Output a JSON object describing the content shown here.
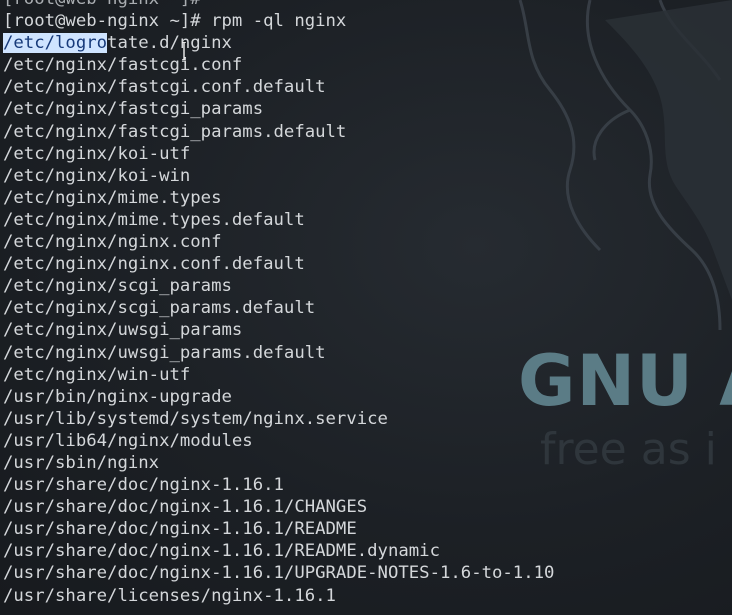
{
  "terminal": {
    "lines": [
      {
        "text": "[root@web-nginx ~]#"
      },
      {
        "text": "[root@web-nginx ~]# rpm -ql nginx"
      },
      {
        "selected": "/etc/logro",
        "rest": "tate.d/nginx"
      },
      {
        "text": "/etc/nginx/fastcgi.conf"
      },
      {
        "text": "/etc/nginx/fastcgi.conf.default"
      },
      {
        "text": "/etc/nginx/fastcgi_params"
      },
      {
        "text": "/etc/nginx/fastcgi_params.default"
      },
      {
        "text": "/etc/nginx/koi-utf"
      },
      {
        "text": "/etc/nginx/koi-win"
      },
      {
        "text": "/etc/nginx/mime.types"
      },
      {
        "text": "/etc/nginx/mime.types.default"
      },
      {
        "text": "/etc/nginx/nginx.conf"
      },
      {
        "text": "/etc/nginx/nginx.conf.default"
      },
      {
        "text": "/etc/nginx/scgi_params"
      },
      {
        "text": "/etc/nginx/scgi_params.default"
      },
      {
        "text": "/etc/nginx/uwsgi_params"
      },
      {
        "text": "/etc/nginx/uwsgi_params.default"
      },
      {
        "text": "/etc/nginx/win-utf"
      },
      {
        "text": "/usr/bin/nginx-upgrade"
      },
      {
        "text": "/usr/lib/systemd/system/nginx.service"
      },
      {
        "text": "/usr/lib64/nginx/modules"
      },
      {
        "text": "/usr/sbin/nginx"
      },
      {
        "text": "/usr/share/doc/nginx-1.16.1"
      },
      {
        "text": "/usr/share/doc/nginx-1.16.1/CHANGES"
      },
      {
        "text": "/usr/share/doc/nginx-1.16.1/README"
      },
      {
        "text": "/usr/share/doc/nginx-1.16.1/README.dynamic"
      },
      {
        "text": "/usr/share/doc/nginx-1.16.1/UPGRADE-NOTES-1.6-to-1.10"
      },
      {
        "text": "/usr/share/licenses/nginx-1.16.1"
      }
    ]
  },
  "wallpaper": {
    "brand": "GNU A",
    "tagline": "free as i"
  },
  "colors": {
    "background": "#1c2025",
    "terminal_text": "#d4d7da",
    "selection_bg": "#cfe4ff",
    "selection_fg": "#173a7a",
    "brand": "#5b7c86"
  }
}
